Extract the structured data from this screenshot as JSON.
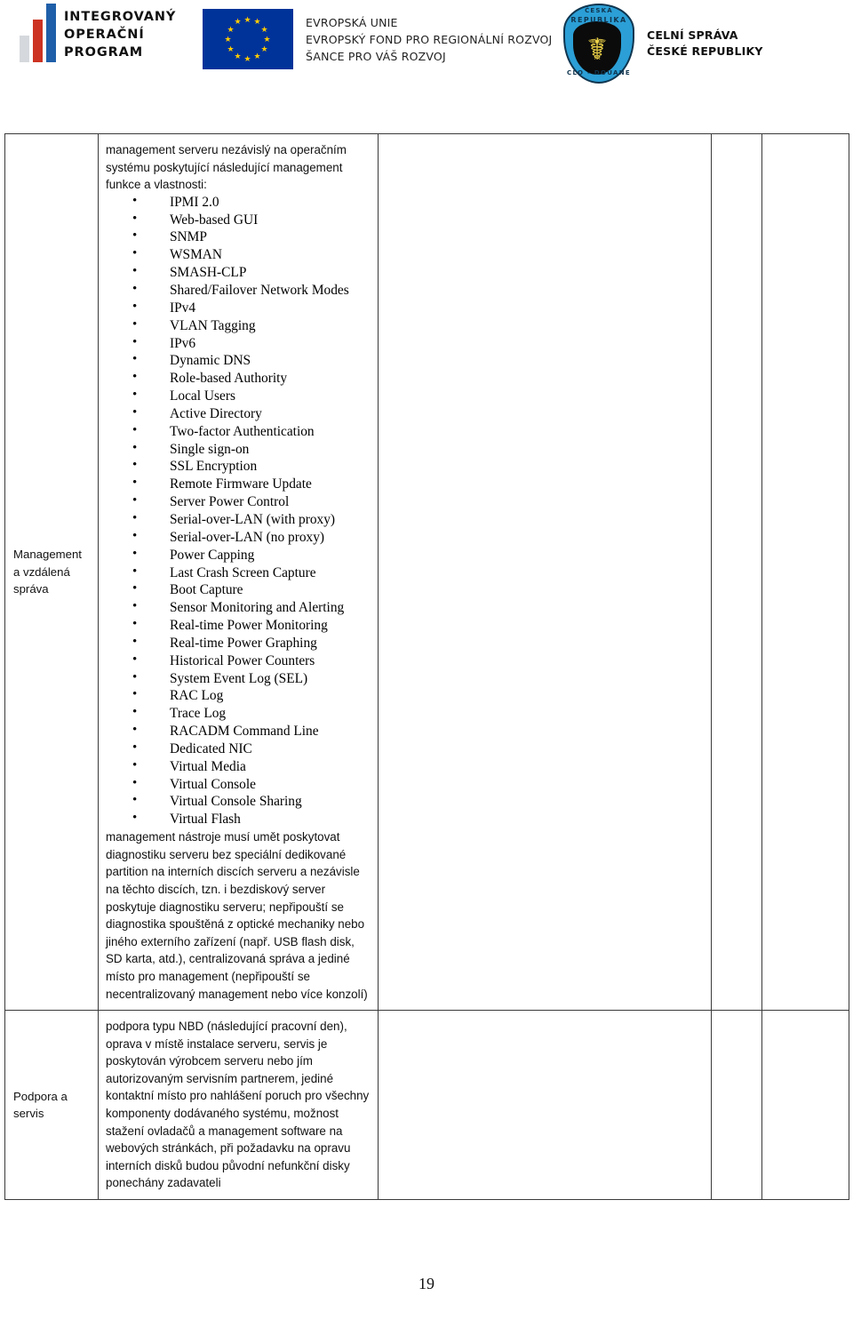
{
  "header": {
    "iop_logo": {
      "name": "integrovany-operacni-program-logo",
      "line1": "INTEGROVANÝ",
      "line2": "OPERAČNÍ",
      "line3": "PROGRAM"
    },
    "eu_logo": {
      "name": "european-union-flag",
      "line1": "EVROPSKÁ UNIE",
      "line2": "EVROPSKÝ FOND PRO REGIONÁLNÍ ROZVOJ",
      "line3": "ŠANCE PRO VÁŠ ROZVOJ"
    },
    "customs_logo": {
      "name": "celni-sprava-emblem",
      "emblem_top": "ČESKÁ",
      "emblem_mid": "REPUBLIKA",
      "emblem_bottom": "CLO - DOUANE",
      "line1": "CELNÍ SPRÁVA",
      "line2": "ČESKÉ REPUBLIKY"
    }
  },
  "table": {
    "rows": [
      {
        "label": "Management a vzdálená správa",
        "intro": "management serveru nezávislý na operačním systému poskytující následující management funkce a vlastnosti:",
        "features": [
          "IPMI 2.0",
          "Web-based GUI",
          "SNMP",
          "WSMAN",
          "SMASH-CLP",
          "Shared/Failover Network Modes",
          "IPv4",
          "VLAN Tagging",
          "IPv6",
          "Dynamic DNS",
          "Role-based Authority",
          "Local Users",
          "Active Directory",
          "Two-factor Authentication",
          "Single sign-on",
          "SSL Encryption",
          "Remote Firmware Update",
          "Server Power Control",
          "Serial-over-LAN (with proxy)",
          "Serial-over-LAN (no proxy)",
          "Power Capping",
          "Last Crash Screen Capture",
          "Boot Capture",
          "Sensor Monitoring and Alerting",
          "Real-time Power Monitoring",
          "Real-time Power Graphing",
          "Historical Power Counters",
          "System Event Log (SEL)",
          "RAC Log",
          "Trace Log",
          "RACADM Command Line",
          "Dedicated NIC",
          "Virtual Media",
          "Virtual Console",
          "Virtual Console Sharing",
          "Virtual Flash"
        ],
        "outro": "management nástroje musí umět poskytovat diagnostiku serveru bez speciální dedikované partition na interních discích serveru a nezávisle na těchto discích, tzn. i bezdiskový server poskytuje diagnostiku serveru; nepřipouští se diagnostika spouštěná z optické mechaniky nebo jiného externího zařízení (např. USB flash disk, SD karta, atd.), centralizovaná správa a jediné místo pro management (nepřipouští se necentralizovaný management nebo více konzolí)",
        "fill_cell": "",
        "n1_cell": "",
        "n2_cell": ""
      },
      {
        "label": "Podpora a servis",
        "intro": "podpora  typu NBD (následující pracovní den), oprava v místě instalace serveru, servis je poskytován výrobcem serveru nebo jím autorizovaným servisním partnerem,  jediné kontaktní místo pro nahlášení poruch pro všechny komponenty dodávaného systému, možnost stažení ovladačů a management software na webových stránkách, při požadavku na opravu interních disků budou původní nefunkční disky ponechány zadavateli",
        "features": [],
        "outro": "",
        "fill_cell": "",
        "n1_cell": "",
        "n2_cell": ""
      }
    ]
  },
  "footer": {
    "page_number": "19"
  },
  "colors": {
    "eu_blue": "#003399",
    "eu_star_yellow": "#FFCC00",
    "iop_blue": "#1f5fa9",
    "iop_red": "#cc3322",
    "customs_blue": "#2b9fd6",
    "border": "#3a3a3a"
  }
}
